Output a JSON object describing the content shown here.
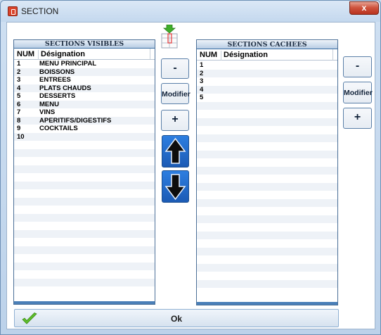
{
  "window": {
    "title": "SECTION",
    "close_label": "x"
  },
  "visible_panel": {
    "title": "SECTIONS VISIBLES",
    "col_num": "NUM",
    "col_designation": "Désignation",
    "rows": [
      {
        "num": "1",
        "label": "MENU PRINCIPAL"
      },
      {
        "num": "2",
        "label": "BOISSONS"
      },
      {
        "num": "3",
        "label": "ENTREES"
      },
      {
        "num": "4",
        "label": "PLATS CHAUDS"
      },
      {
        "num": "5",
        "label": "DESSERTS"
      },
      {
        "num": "6",
        "label": "MENU"
      },
      {
        "num": "7",
        "label": "VINS"
      },
      {
        "num": "8",
        "label": "APERITIFS/DIGESTIFS"
      },
      {
        "num": "9",
        "label": "COCKTAILS"
      },
      {
        "num": "10",
        "label": ""
      }
    ]
  },
  "hidden_panel": {
    "title": "SECTIONS CACHEES",
    "col_num": "NUM",
    "col_designation": "Désignation",
    "rows": [
      {
        "num": "1",
        "label": ""
      },
      {
        "num": "2",
        "label": ""
      },
      {
        "num": "3",
        "label": ""
      },
      {
        "num": "4",
        "label": ""
      },
      {
        "num": "5",
        "label": ""
      }
    ]
  },
  "controls": {
    "minus_label": "-",
    "modify_label": "Modifier",
    "plus_label": "+",
    "move_up_icon": "arrow-up-icon",
    "move_down_icon": "arrow-down-icon"
  },
  "footer": {
    "ok_label": "Ok",
    "icon": "check-icon"
  },
  "colors": {
    "accent": "#2d7ee0",
    "panel_border": "#4b6f97",
    "row_alt": "#eef2f7"
  }
}
